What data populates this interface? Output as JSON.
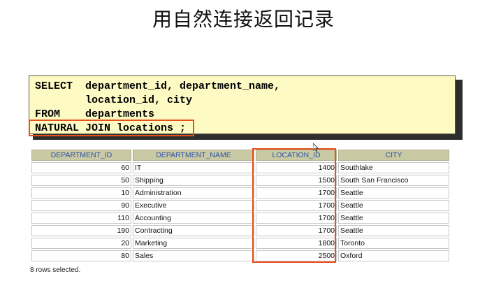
{
  "slide": {
    "title": "用自然连接返回记录"
  },
  "sql": {
    "lines": [
      {
        "kw": "SELECT",
        "rest": "department_id, department_name,"
      },
      {
        "kw": "",
        "rest": "location_id, city"
      },
      {
        "kw": "FROM",
        "rest": "departments"
      },
      {
        "kw": "NATURAL JOIN locations",
        "rest": " ;"
      }
    ]
  },
  "table": {
    "headers": [
      "DEPARTMENT_ID",
      "DEPARTMENT_NAME",
      "LOCATION_ID",
      "CITY"
    ],
    "rows": [
      [
        "60",
        "IT",
        "1400",
        "Southlake"
      ],
      [
        "50",
        "Shipping",
        "1500",
        "South San Francisco"
      ],
      [
        "10",
        "Administration",
        "1700",
        "Seattle"
      ],
      [
        "90",
        "Executive",
        "1700",
        "Seattle"
      ],
      [
        "110",
        "Accounting",
        "1700",
        "Seattle"
      ],
      [
        "190",
        "Contracting",
        "1700",
        "Seattle"
      ],
      [
        "20",
        "Marketing",
        "1800",
        "Toronto"
      ],
      [
        "80",
        "Sales",
        "2500",
        "Oxford"
      ]
    ]
  },
  "footer": {
    "text": "8 rows selected."
  },
  "colors": {
    "highlight": "#e8501a",
    "sql_bg": "#fdfac4",
    "header_bg": "#c9c9a4",
    "header_text": "#2e55a6"
  }
}
